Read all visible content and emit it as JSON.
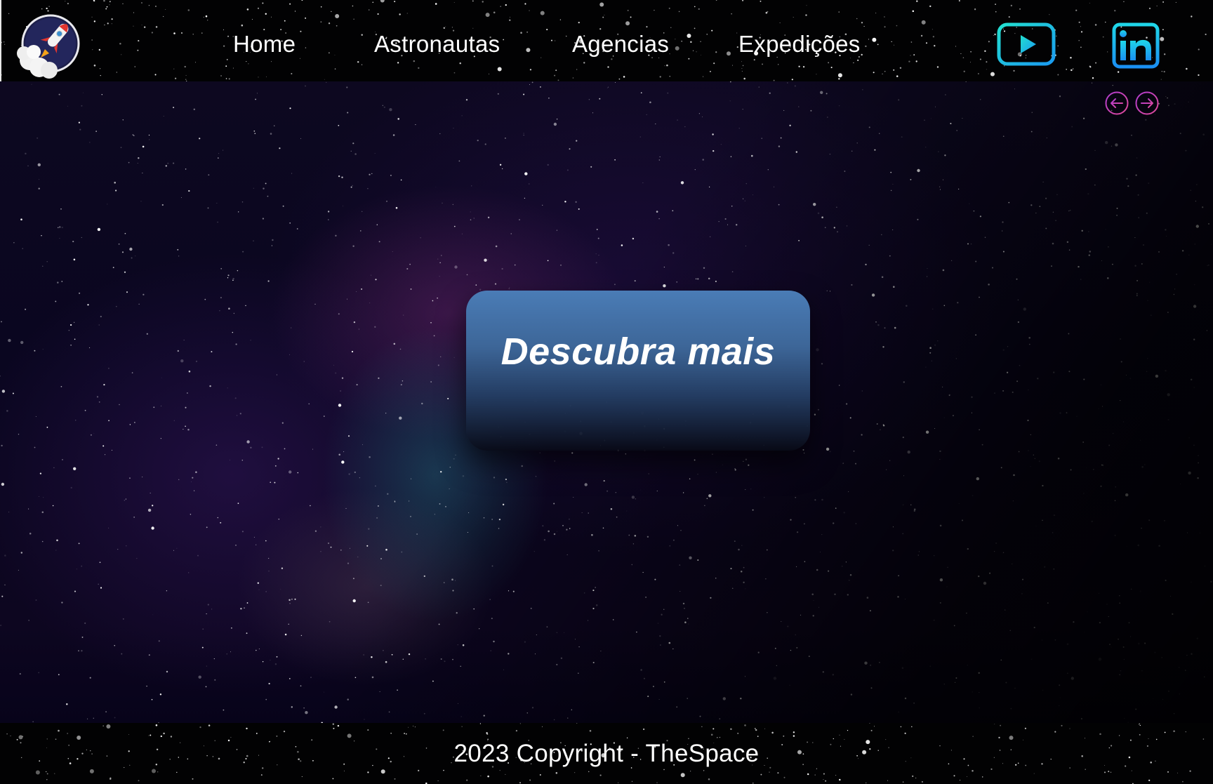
{
  "nav": {
    "items": [
      {
        "label": "Home"
      },
      {
        "label": "Astronautas"
      },
      {
        "label": "Agencias"
      },
      {
        "label": "Expedições"
      }
    ]
  },
  "social": {
    "youtube_icon": "youtube-icon",
    "linkedin_icon": "linkedin-icon",
    "linkedin_text": "in"
  },
  "hero": {
    "cta_label": "Descubra mais",
    "prev_icon": "arrow-left-icon",
    "next_icon": "arrow-right-icon"
  },
  "footer": {
    "copyright": "2023 Copyright - TheSpace"
  },
  "colors": {
    "accent_teal": "#1ed0d8",
    "accent_blue": "#1aa0f0",
    "cta_blue": "#4a7cb6",
    "arrow_outline": "#c040c0"
  }
}
